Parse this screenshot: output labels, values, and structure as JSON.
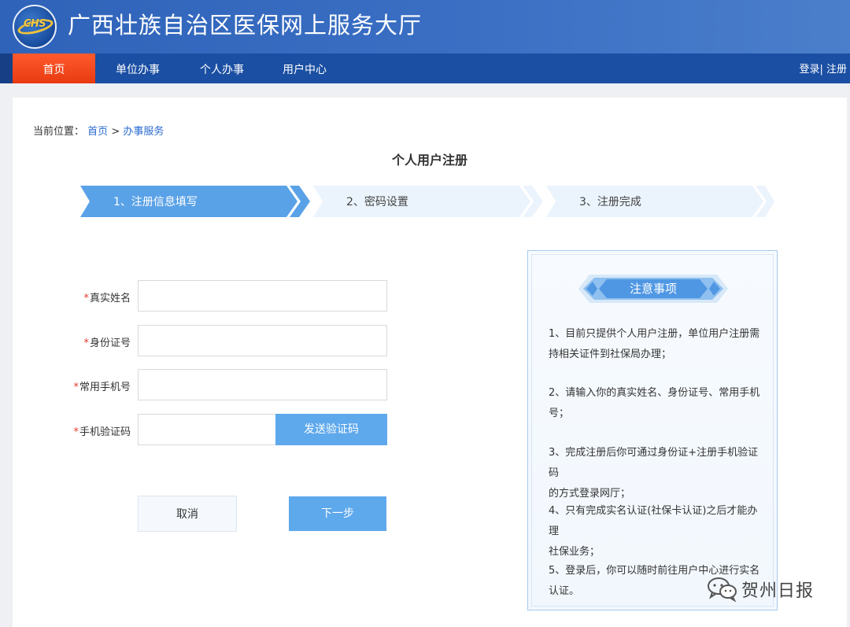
{
  "header": {
    "logo_text": "CHS",
    "site_title": "广西壮族自治区医保网上服务大厅"
  },
  "nav": {
    "items": [
      {
        "label": "首页",
        "active": true
      },
      {
        "label": "单位办事",
        "active": false
      },
      {
        "label": "个人办事",
        "active": false
      },
      {
        "label": "用户中心",
        "active": false
      }
    ],
    "login": "登录",
    "separator": "|",
    "register": "注册"
  },
  "breadcrumb": {
    "prefix": "当前位置：",
    "home": "首页",
    "sep": ">",
    "current": "办事服务"
  },
  "page_title": "个人用户注册",
  "steps": [
    {
      "label": "1、注册信息填写",
      "active": true
    },
    {
      "label": "2、密码设置",
      "active": false
    },
    {
      "label": "3、注册完成",
      "active": false
    }
  ],
  "form": {
    "required_mark": "*",
    "fields": [
      {
        "label": "真实姓名",
        "value": "",
        "placeholder": ""
      },
      {
        "label": "身份证号",
        "value": "",
        "placeholder": ""
      },
      {
        "label": "常用手机号",
        "value": "",
        "placeholder": ""
      },
      {
        "label": "手机验证码",
        "value": "",
        "placeholder": ""
      }
    ],
    "send_code_label": "发送验证码",
    "cancel_label": "取消",
    "next_label": "下一步"
  },
  "notice": {
    "title": "注意事项",
    "items": [
      {
        "line1": "1、目前只提供个人用户注册，单位用户注册需",
        "line2": "持相关证件到社保局办理；"
      },
      {
        "line1": "2、请输入你的真实姓名、身份证号、常用手机",
        "line2": "号；"
      },
      {
        "line1": "3、完成注册后你可通过身份证+注册手机验证码",
        "line2": "的方式登录网厅；"
      },
      {
        "line1": "4、只有完成实名认证(社保卡认证)之后才能办理",
        "line2": "社保业务；"
      },
      {
        "line1": "5、登录后，你可以随时前往用户中心进行实名",
        "line2": "认证。"
      }
    ]
  },
  "watermark": {
    "text": "贺州日报",
    "icon": "wechat-icon"
  },
  "colors": {
    "header_blue": "#2f63b9",
    "nav_blue": "#1b4fa3",
    "nav_active": "#e83a10",
    "step_active": "#5ba3e8",
    "step_inactive": "#eaf3fc",
    "primary_button": "#5ea8ec",
    "required": "#e13a2a",
    "link": "#2a6bd1"
  }
}
